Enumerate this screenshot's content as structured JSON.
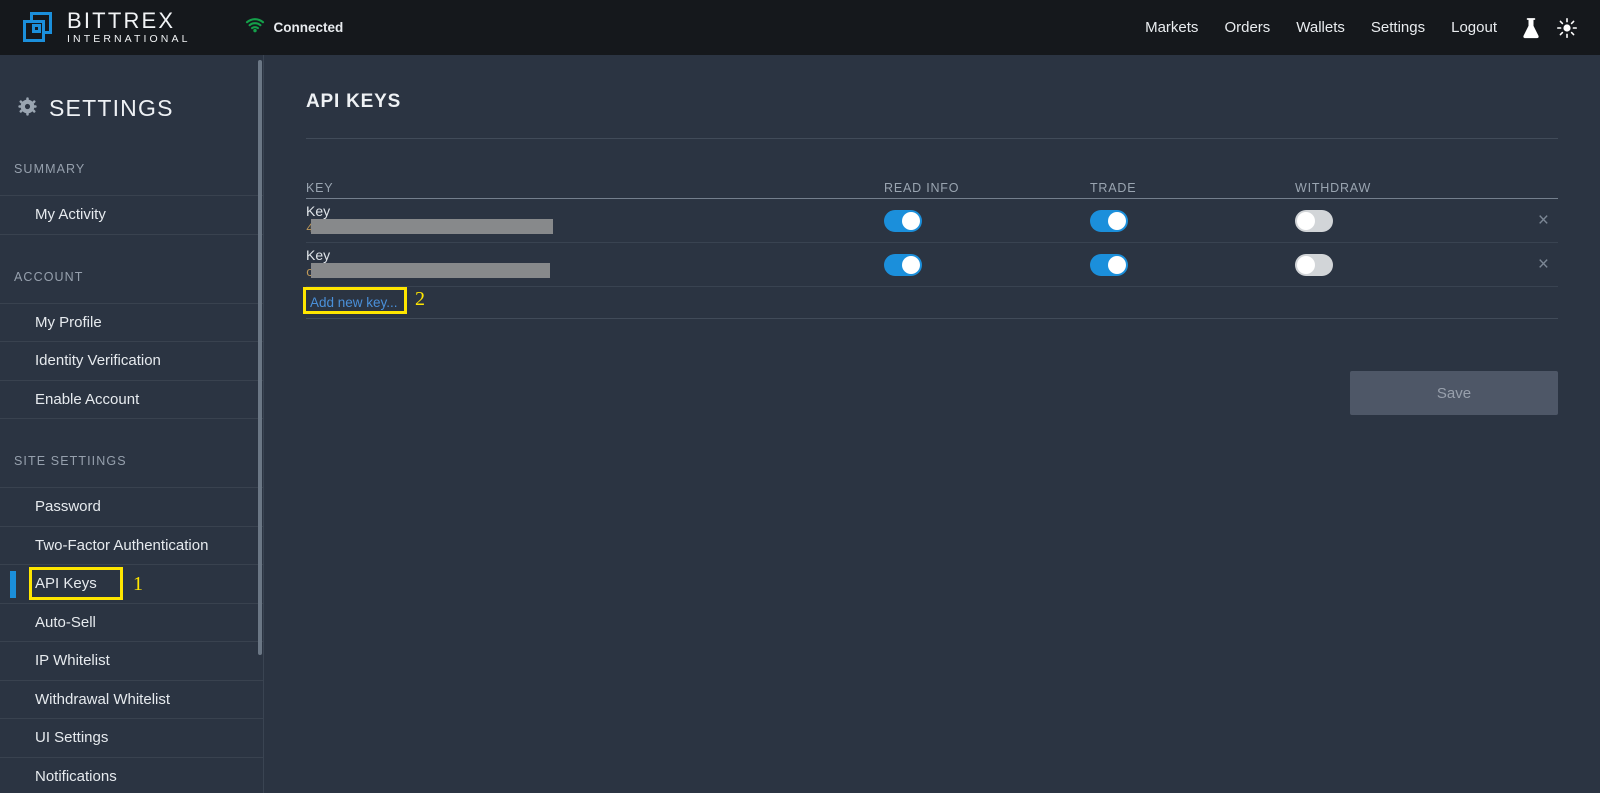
{
  "topbar": {
    "brand_main": "BITTREX",
    "brand_sub": "INTERNATIONAL",
    "connection_status": "Connected",
    "status_color": "#14a04a",
    "nav": [
      {
        "label": "Markets"
      },
      {
        "label": "Orders"
      },
      {
        "label": "Wallets"
      },
      {
        "label": "Settings"
      },
      {
        "label": "Logout"
      }
    ],
    "icons": [
      {
        "name": "flask-icon"
      },
      {
        "name": "brightness-icon"
      }
    ]
  },
  "sidebar": {
    "title": "SETTINGS",
    "groups": [
      {
        "label": "SUMMARY",
        "items": [
          {
            "label": "My Activity",
            "active": false
          }
        ]
      },
      {
        "label": "ACCOUNT",
        "items": [
          {
            "label": "My Profile",
            "active": false
          },
          {
            "label": "Identity Verification",
            "active": false
          },
          {
            "label": "Enable Account",
            "active": false
          }
        ]
      },
      {
        "label": "SITE SETTIINGS",
        "items": [
          {
            "label": "Password",
            "active": false
          },
          {
            "label": "Two-Factor Authentication",
            "active": false
          },
          {
            "label": "API Keys",
            "active": true
          },
          {
            "label": "Auto-Sell",
            "active": false
          },
          {
            "label": "IP Whitelist",
            "active": false
          },
          {
            "label": "Withdrawal Whitelist",
            "active": false
          },
          {
            "label": "UI Settings",
            "active": false
          },
          {
            "label": "Notifications",
            "active": false
          }
        ]
      }
    ]
  },
  "main": {
    "page_title": "API KEYS",
    "columns": {
      "key": "KEY",
      "read_info": "READ INFO",
      "trade": "TRADE",
      "withdraw": "WITHDRAW"
    },
    "rows": [
      {
        "key_label": "Key",
        "key_value": "4",
        "key_redacted": true,
        "redact_width": 242,
        "read_info": true,
        "trade": true,
        "withdraw": false,
        "delete_label": "×"
      },
      {
        "key_label": "Key",
        "key_value": "c",
        "key_redacted": true,
        "redact_width": 239,
        "read_info": true,
        "trade": true,
        "withdraw": false,
        "delete_label": "×"
      }
    ],
    "add_new_key_label": "Add new key...",
    "save_label": "Save"
  },
  "annotations": [
    {
      "number": "1",
      "target": "API Keys"
    },
    {
      "number": "2",
      "target": "Add new key..."
    }
  ],
  "colors": {
    "accent_blue": "#1b8fdb",
    "highlight_yellow": "#ffe600",
    "topbar_bg": "#15181c",
    "page_bg": "#2b3442",
    "link_blue": "#4a90d9"
  }
}
